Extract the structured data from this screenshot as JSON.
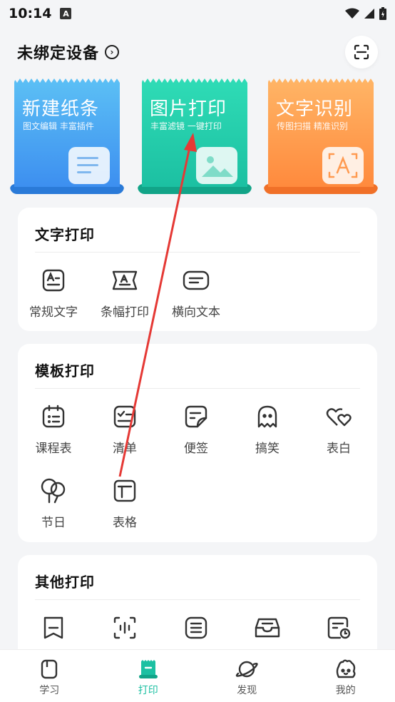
{
  "status": {
    "time": "10:14"
  },
  "header": {
    "title": "未绑定设备"
  },
  "features": [
    {
      "title": "新建纸条",
      "subtitle": "图文编辑 丰富插件"
    },
    {
      "title": "图片打印",
      "subtitle": "丰富滤镜 一键打印"
    },
    {
      "title": "文字识别",
      "subtitle": "传图扫描 精准识别"
    }
  ],
  "text_print": {
    "title": "文字打印",
    "items": [
      {
        "label": "常规文字",
        "icon": "text-a-icon"
      },
      {
        "label": "条幅打印",
        "icon": "banner-icon"
      },
      {
        "label": "横向文本",
        "icon": "horizontal-text-icon"
      }
    ]
  },
  "template_print": {
    "title": "模板打印",
    "items": [
      {
        "label": "课程表",
        "icon": "calendar-icon"
      },
      {
        "label": "清单",
        "icon": "checklist-icon"
      },
      {
        "label": "便签",
        "icon": "sticky-note-icon"
      },
      {
        "label": "搞笑",
        "icon": "ghost-icon"
      },
      {
        "label": "表白",
        "icon": "hearts-icon"
      },
      {
        "label": "节日",
        "icon": "balloons-icon"
      },
      {
        "label": "表格",
        "icon": "table-icon"
      }
    ]
  },
  "other_print": {
    "title": "其他打印",
    "items": [
      {
        "icon": "bookmark-icon"
      },
      {
        "icon": "voice-scan-icon"
      },
      {
        "icon": "list-icon"
      },
      {
        "icon": "tray-icon"
      },
      {
        "icon": "schedule-icon"
      }
    ]
  },
  "bottom_nav": [
    {
      "label": "学习",
      "icon": "book-icon"
    },
    {
      "label": "打印",
      "icon": "print-icon",
      "active": true
    },
    {
      "label": "发现",
      "icon": "planet-icon"
    },
    {
      "label": "我的",
      "icon": "mascot-icon"
    }
  ],
  "colors": {
    "accent": "#1cc0a2",
    "annotation_arrow": "#e53935"
  }
}
